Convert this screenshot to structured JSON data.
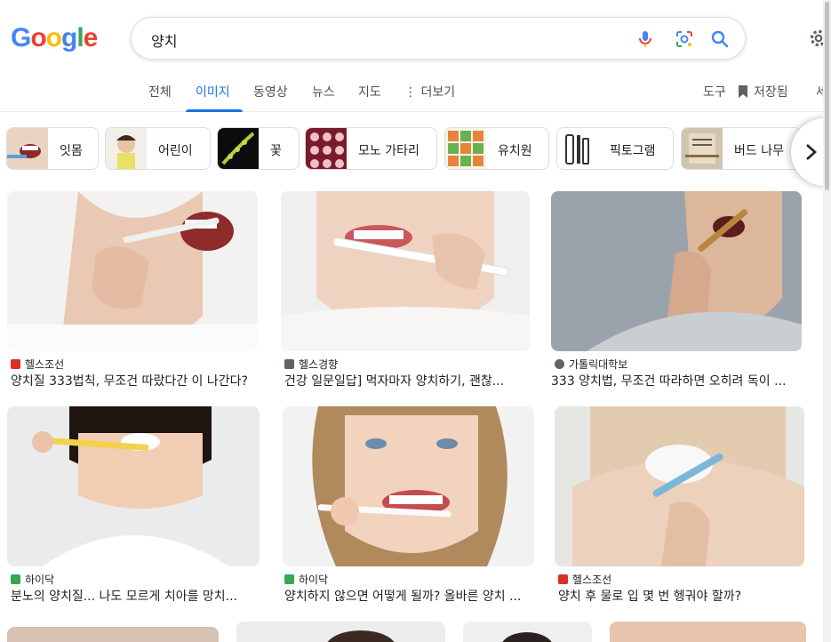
{
  "search": {
    "query": "양치"
  },
  "tabs": [
    {
      "label": "전체"
    },
    {
      "label": "이미지"
    },
    {
      "label": "동영상"
    },
    {
      "label": "뉴스"
    },
    {
      "label": "지도"
    },
    {
      "label": "더보기"
    }
  ],
  "tools": {
    "tools_label": "도구",
    "saved_label": "저장됨",
    "safe_label": "세"
  },
  "chips": [
    {
      "label": "잇몸"
    },
    {
      "label": "어린이"
    },
    {
      "label": "꽃"
    },
    {
      "label": "모노 가타리"
    },
    {
      "label": "유치원"
    },
    {
      "label": "픽토그램"
    },
    {
      "label": "버드 나무"
    }
  ],
  "results": [
    {
      "source": "헬스조선",
      "title": "양치질 333법칙, 무조건 따랐다간 이 나간다?",
      "fav_color": "#d93025"
    },
    {
      "source": "헬스경향",
      "title": "건강 일문일답] 먹자마자 양치하기, 괜찮...",
      "fav_color": "#5f6368"
    },
    {
      "source": "가톨릭대학보",
      "title": "333 양치법, 무조건 따라하면 오히려 독이 ...",
      "fav_color": "#5f6368"
    },
    {
      "source": "하이닥",
      "title": "분노의 양치질... 나도 모르게 치아를 망치...",
      "fav_color": "#34a853"
    },
    {
      "source": "하이닥",
      "title": "양치하지 않으면 어떻게 될까? 올바른 양치 ...",
      "fav_color": "#34a853"
    },
    {
      "source": "헬스조선",
      "title": "양치 후 물로 입 몇 번 헹궈야 할까?",
      "fav_color": "#d93025"
    }
  ],
  "colors": {
    "accent": "#1a73e8",
    "border": "#dadce0"
  }
}
